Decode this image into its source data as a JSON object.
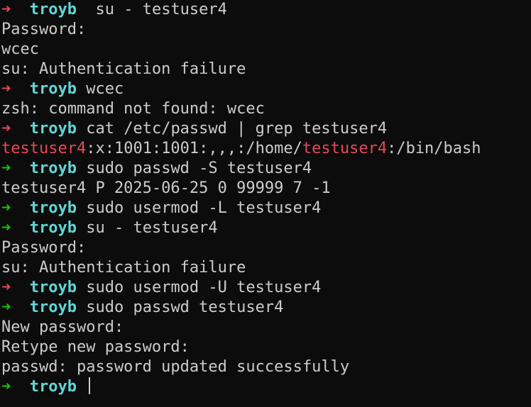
{
  "terminal": {
    "prompt_user": "troyb",
    "lines": [
      {
        "type": "prompt",
        "status": "error",
        "cmd": " su - testuser4"
      },
      {
        "type": "output",
        "text": "Password:"
      },
      {
        "type": "output",
        "text": "wcec"
      },
      {
        "type": "output",
        "text": "su: Authentication failure"
      },
      {
        "type": "prompt",
        "status": "error",
        "cmd": "wcec"
      },
      {
        "type": "output",
        "text": "zsh: command not found: wcec"
      },
      {
        "type": "prompt",
        "status": "error",
        "cmd": "cat /etc/passwd | grep testuser4"
      },
      {
        "type": "grep",
        "parts": [
          {
            "text": "testuser4",
            "highlight": true
          },
          {
            "text": ":x:1001:1001:,,,:/home/",
            "highlight": false
          },
          {
            "text": "testuser4",
            "highlight": true
          },
          {
            "text": ":/bin/bash",
            "highlight": false
          }
        ]
      },
      {
        "type": "prompt",
        "status": "ok",
        "cmd": "sudo passwd -S testuser4"
      },
      {
        "type": "output",
        "text": "testuser4 P 2025-06-25 0 99999 7 -1"
      },
      {
        "type": "prompt",
        "status": "ok",
        "cmd": "sudo usermod -L testuser4"
      },
      {
        "type": "prompt",
        "status": "ok",
        "cmd": "su - testuser4"
      },
      {
        "type": "output",
        "text": "Password:"
      },
      {
        "type": "output",
        "text": "su: Authentication failure"
      },
      {
        "type": "prompt",
        "status": "error",
        "cmd": "sudo usermod -U testuser4"
      },
      {
        "type": "prompt",
        "status": "ok",
        "cmd": "sudo passwd testuser4"
      },
      {
        "type": "output",
        "text": "New password:"
      },
      {
        "type": "output",
        "text": "Retype new password:"
      },
      {
        "type": "output",
        "text": "passwd: password updated successfully"
      },
      {
        "type": "current",
        "status": "ok",
        "cmd": ""
      }
    ]
  },
  "colors": {
    "background": "#0c0c0c",
    "text": "#cccccc",
    "arrow_error": "#e74856",
    "arrow_ok": "#16c60c",
    "prompt_user": "#61d6d6",
    "grep_highlight": "#e74856"
  },
  "icons": {
    "prompt_arrow": "right-arrow-icon"
  }
}
